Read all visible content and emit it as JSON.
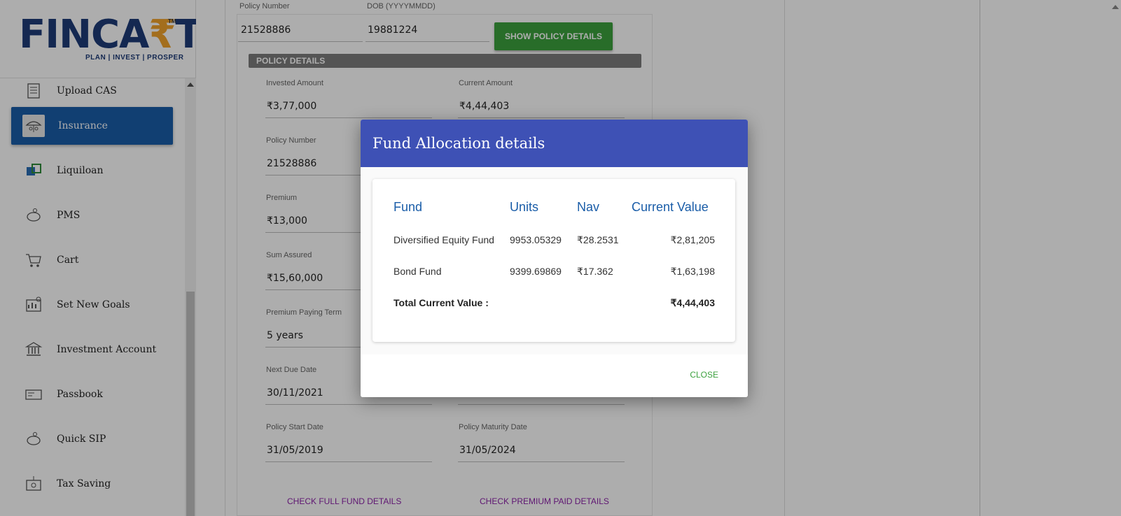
{
  "brand": {
    "logo_text_before": "FINCA",
    "logo_rupee": "₹",
    "logo_text_after": "T",
    "tm": "TM",
    "tagline": "PLAN | INVEST | PROSPER",
    "primary_color": "#1a5da8",
    "accent_color": "#f0a22c"
  },
  "sidebar": {
    "items": [
      {
        "label": "Upload CAS",
        "icon": "document-list-icon"
      },
      {
        "label": "Insurance",
        "icon": "umbrella-family-icon",
        "active": true
      },
      {
        "label": "Liquiloan",
        "icon": "liquiloan-icon"
      },
      {
        "label": "PMS",
        "icon": "piggy-bank-icon"
      },
      {
        "label": "Cart",
        "icon": "cart-icon"
      },
      {
        "label": "Set New Goals",
        "icon": "goals-icon"
      },
      {
        "label": "Investment Account",
        "icon": "bank-icon"
      },
      {
        "label": "Passbook",
        "icon": "passbook-icon"
      },
      {
        "label": "Quick SIP",
        "icon": "piggy-bank-icon"
      },
      {
        "label": "Tax Saving",
        "icon": "tax-icon"
      }
    ]
  },
  "form": {
    "policy_number_label": "Policy Number",
    "policy_number_value": "21528886",
    "dob_label": "DOB (YYYYMMDD)",
    "dob_value": "19881224",
    "show_button": "SHOW POLICY DETAILS",
    "section_title": "POLICY DETAILS",
    "fields": {
      "invested_amount_label": "Invested Amount",
      "invested_amount_value": "₹3,77,000",
      "current_amount_label": "Current Amount",
      "current_amount_value": "₹4,44,403",
      "policy_number_label": "Policy Number",
      "policy_number_value": "21528886",
      "premium_label": "Premium",
      "premium_value": "₹13,000",
      "sum_assured_label": "Sum Assured",
      "sum_assured_value": "₹15,60,000",
      "premium_paying_term_label": "Premium Paying Term",
      "premium_paying_term_value": "5 years",
      "next_due_date_label": "Next Due Date",
      "next_due_date_value": "30/11/2021",
      "policy_start_date_label": "Policy Start Date",
      "policy_start_date_value": "31/05/2019",
      "policy_maturity_date_label": "Policy Maturity Date",
      "policy_maturity_date_value": "31/05/2024"
    },
    "check_fund_button": "CHECK FULL FUND DETAILS",
    "check_premium_button": "CHECK PREMIUM PAID DETAILS"
  },
  "modal": {
    "title": "Fund Allocation details",
    "header_color": "#3e51b5",
    "columns": [
      "Fund",
      "Units",
      "Nav",
      "Current Value"
    ],
    "rows": [
      {
        "fund": "Diversified Equity Fund",
        "units": "9953.05329",
        "nav": "₹28.2531",
        "value": "₹2,81,205"
      },
      {
        "fund": "Bond Fund",
        "units": "9399.69869",
        "nav": "₹17.362",
        "value": "₹1,63,198"
      }
    ],
    "total_label": "Total Current Value :",
    "total_value": "₹4,44,403",
    "close_label": "CLOSE"
  }
}
